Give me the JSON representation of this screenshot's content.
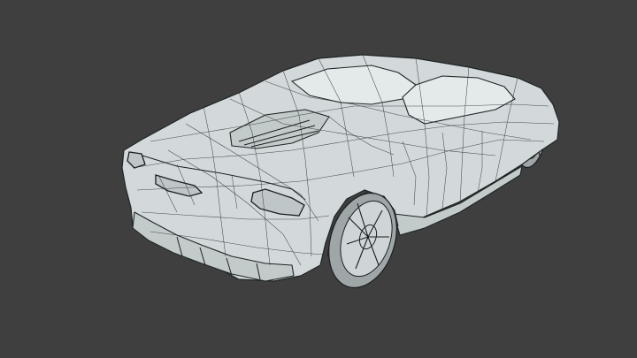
{
  "scene": {
    "background_color": "#3f3f3f",
    "model_fill_color": "#d3d9da",
    "wire_color": "#2d3334",
    "subject": "sports-car-wireframe"
  }
}
